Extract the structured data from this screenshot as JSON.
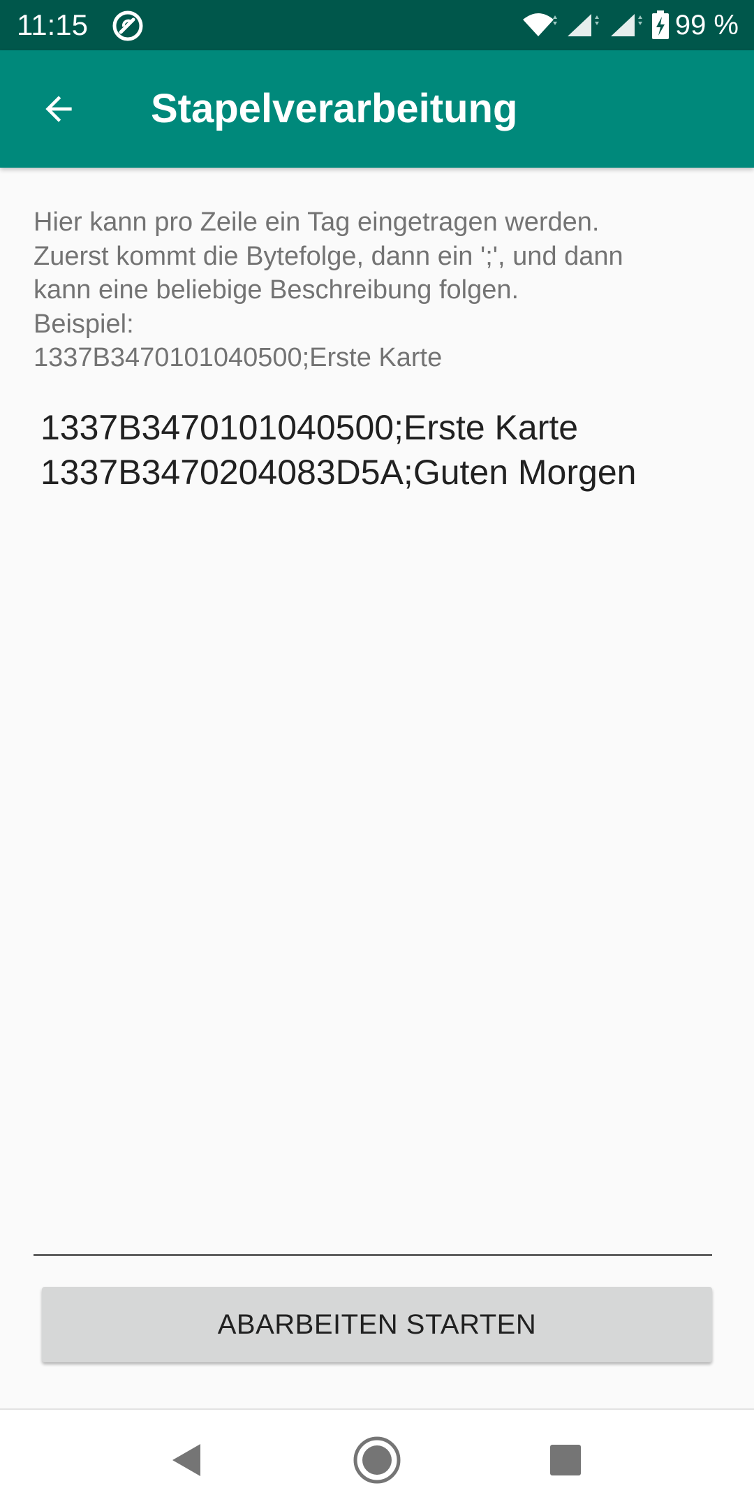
{
  "status_bar": {
    "time": "11:15",
    "battery_text": "99 %",
    "icons": [
      "sync-app-icon",
      "wifi-icon",
      "cell-signal-icon",
      "cell-signal-icon",
      "battery-charging-icon"
    ]
  },
  "app_bar": {
    "title": "Stapelverarbeitung",
    "back_icon": "arrow-back-icon"
  },
  "instructions": {
    "lines": [
      "Hier kann pro Zeile ein Tag eingetragen werden.",
      "Zuerst kommt die Bytefolge, dann ein ';', und dann",
      "kann eine beliebige Beschreibung folgen.",
      "Beispiel:",
      "1337B3470101040500;Erste Karte"
    ]
  },
  "batch_input": {
    "value": "1337B3470101040500;Erste Karte\n1337B3470204083D5A;Guten Morgen"
  },
  "start_button": {
    "label": "ABARBEITEN STARTEN"
  },
  "nav_bar": {
    "icons": [
      "back-triangle-icon",
      "home-circle-icon",
      "recents-square-icon"
    ]
  },
  "colors": {
    "status_bar": "#00574b",
    "app_bar": "#00897b",
    "background": "#fafafa",
    "button": "#d6d7d7",
    "instruction_text": "#737373",
    "input_text": "#212121"
  }
}
